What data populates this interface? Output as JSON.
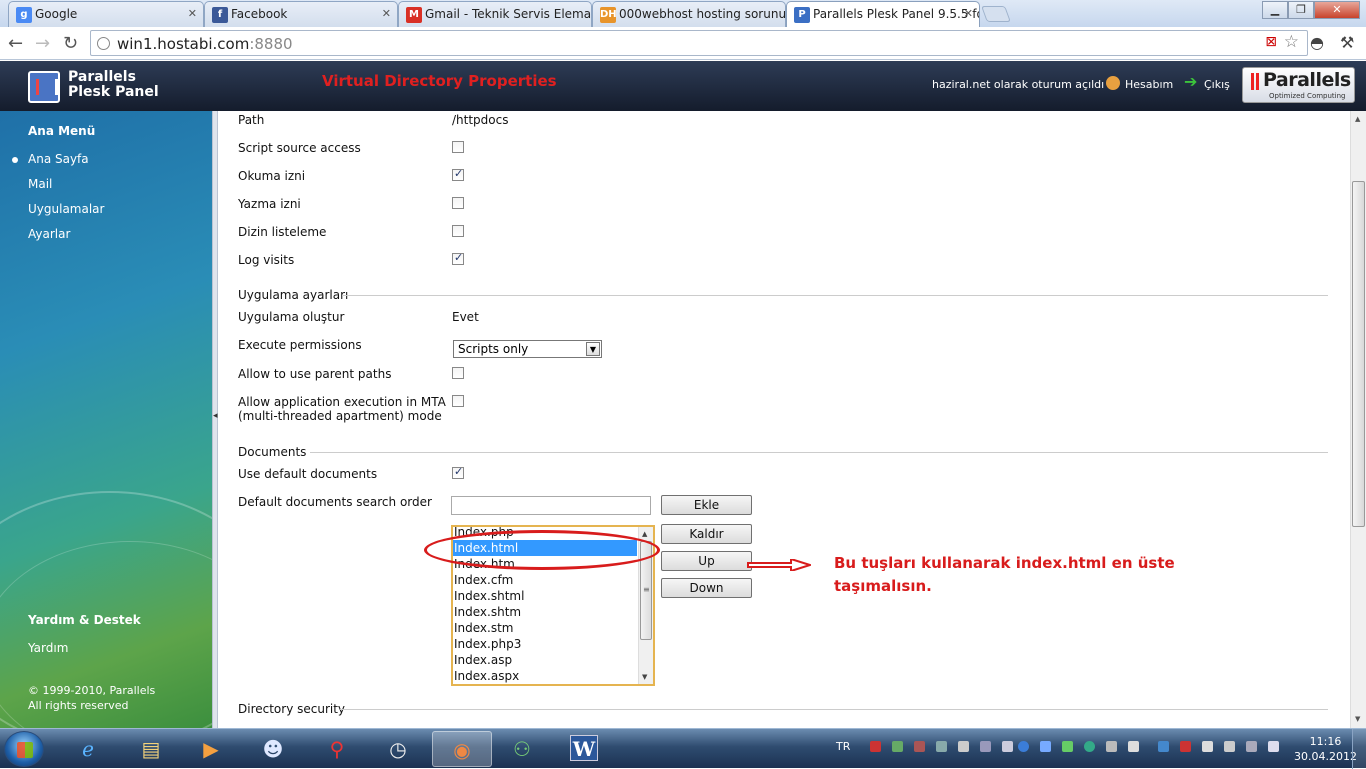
{
  "browser": {
    "tabs": [
      {
        "title": "Google",
        "favicon": "google-icon",
        "color": "#4a8af4"
      },
      {
        "title": "Facebook",
        "favicon": "facebook-icon",
        "color": "#3b5998"
      },
      {
        "title": "Gmail - Teknik Servis Elema",
        "favicon": "gmail-icon",
        "color": "#d93025"
      },
      {
        "title": "000webhost hosting sorunu",
        "favicon": "dh-icon",
        "color": "#e8942a"
      },
      {
        "title": "Parallels Plesk Panel 9.5.5 fo",
        "favicon": "plesk-icon",
        "color": "#3b6fc4"
      }
    ],
    "url_host": "win1.hostabi.com",
    "url_port": ":8880"
  },
  "header": {
    "product_line1": "Parallels",
    "product_line2": "Plesk Panel",
    "page_title": "Virtual Directory Properties",
    "logged_in": "haziral.net olarak oturum açıldı",
    "account": "Hesabım",
    "logout": "Çıkış",
    "brand": "Parallels",
    "brand_sub": "Optimized Computing"
  },
  "sidebar": {
    "main_menu": "Ana Menü",
    "items": [
      "Ana Sayfa",
      "Mail",
      "Uygulamalar",
      "Ayarlar"
    ],
    "help_heading": "Yardım & Destek",
    "help": "Yardım",
    "copyright1": "© 1999-2010, Parallels",
    "copyright2": "All rights reserved"
  },
  "form": {
    "path_label": "Path",
    "path_value": "/httpdocs",
    "script_source_label": "Script source access",
    "script_source": false,
    "read_label": "Okuma izni",
    "read": true,
    "write_label": "Yazma izni",
    "write": false,
    "dir_listing_label": "Dizin listeleme",
    "dir_listing": false,
    "log_visits_label": "Log visits",
    "log_visits": true,
    "app_section": "Uygulama ayarları",
    "create_app_label": "Uygulama oluştur",
    "create_app_value": "Evet",
    "exec_perm_label": "Execute permissions",
    "exec_perm_value": "Scripts only",
    "parent_paths_label": "Allow to use parent paths",
    "parent_paths": false,
    "mta_label_1": "Allow application execution in MTA",
    "mta_label_2": "(multi-threaded apartment) mode",
    "mta": false,
    "docs_section": "Documents",
    "use_default_label": "Use default documents",
    "use_default": true,
    "search_order_label": "Default documents search order",
    "add_button": "Ekle",
    "remove_button": "Kaldır",
    "up_button": "Up",
    "down_button": "Down",
    "documents": [
      "Index.php",
      "Index.html",
      "Index.htm",
      "Index.cfm",
      "Index.shtml",
      "Index.shtm",
      "Index.stm",
      "Index.php3",
      "Index.asp",
      "Index.aspx"
    ],
    "selected_document": "Index.html",
    "dir_security_section": "Directory security"
  },
  "annotation": {
    "line1": "Bu tuşları kullanarak index.html en üste",
    "line2": "taşımalısın.",
    "color": "#d81c1c"
  },
  "taskbar": {
    "apps": [
      "ie-icon",
      "explorer-icon",
      "media-player-icon",
      "contacts-icon",
      "pin-icon",
      "clock-app-icon",
      "chrome-icon",
      "network-icon",
      "word-icon"
    ],
    "language": "TR",
    "time": "11:16",
    "date": "30.04.2012"
  }
}
